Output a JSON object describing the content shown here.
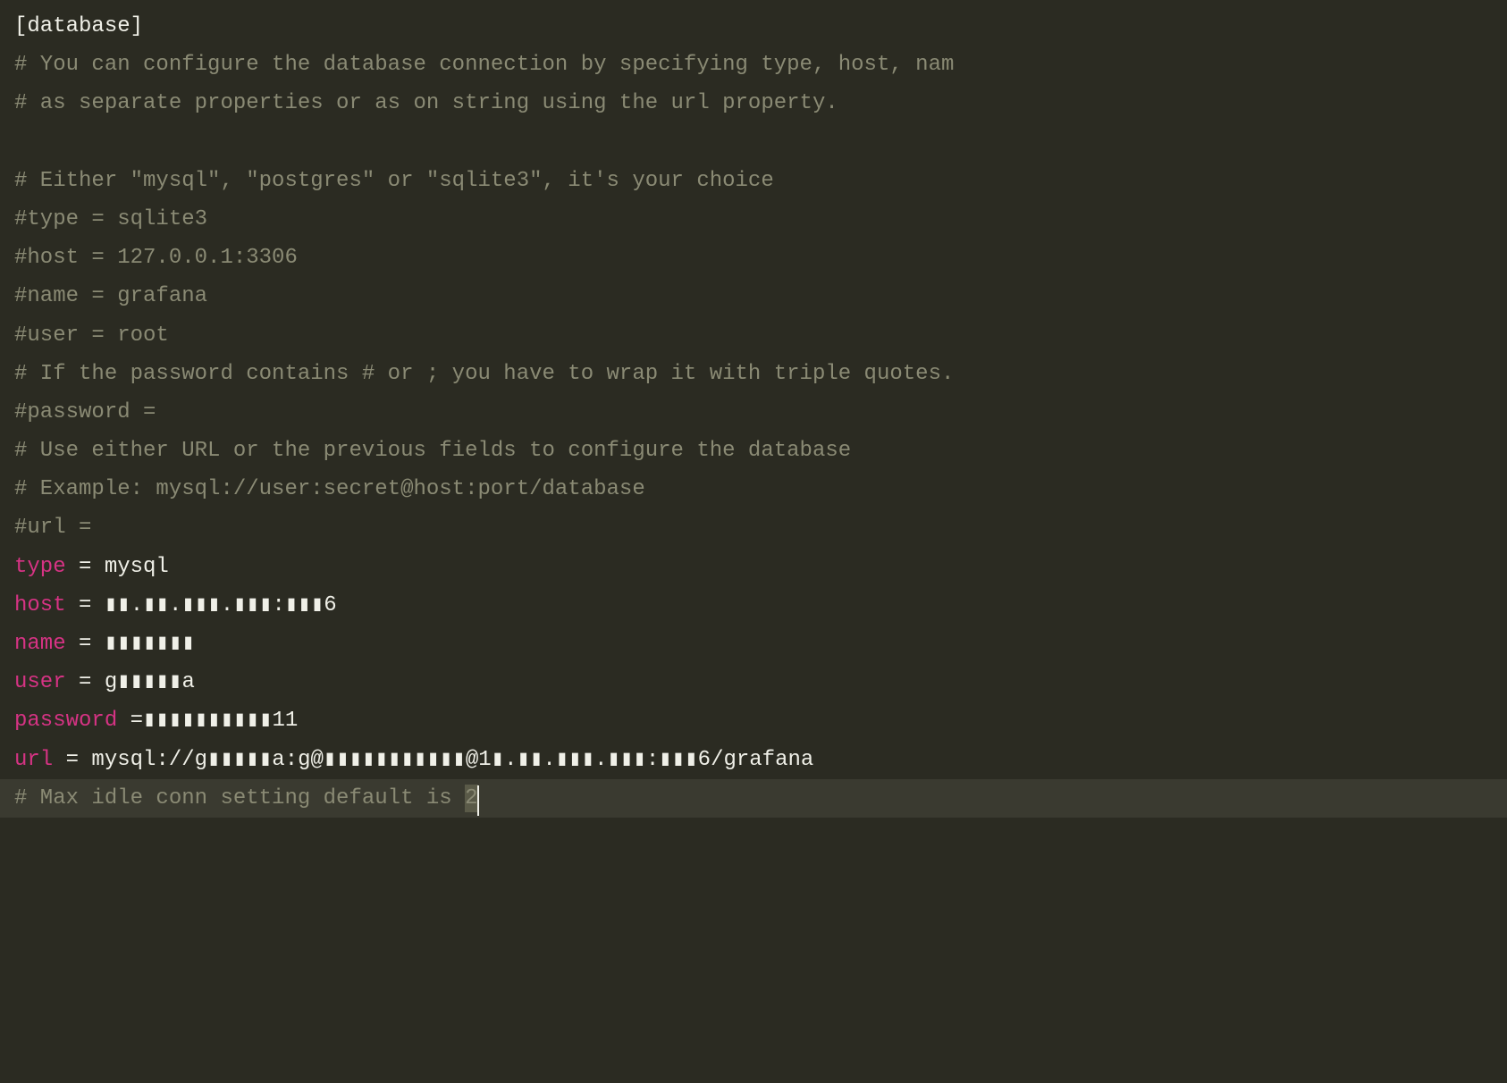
{
  "lines": {
    "l1": "[database]",
    "l2": "# You can configure the database connection by specifying type, host, nam",
    "l3": "# as separate properties or as on string using the url property.",
    "l4": "",
    "l5": "# Either \"mysql\", \"postgres\" or \"sqlite3\", it's your choice",
    "l6": "#type = sqlite3",
    "l7": "#host = 127.0.0.1:3306",
    "l8": "#name = grafana",
    "l9": "#user = root",
    "l10": "# If the password contains # or ; you have to wrap it with triple quotes.",
    "l11": "#password =",
    "l12": "# Use either URL or the previous fields to configure the database",
    "l13": "# Example: mysql://user:secret@host:port/database",
    "l14": "#url =",
    "type_key": "type",
    "type_val": " = mysql",
    "host_key": "host",
    "host_eq": " = ",
    "host_val": "▮▮.▮▮.▮▮▮.▮▮▮:▮▮▮6",
    "name_key": "name",
    "name_eq": " = ",
    "name_val": "▮▮▮▮▮▮▮",
    "user_key": "user",
    "user_eq": " = ",
    "user_val": "g▮▮▮▮▮a",
    "password_key": "password",
    "password_eq": " =",
    "password_val": "▮▮▮▮▮▮▮▮▮▮11",
    "url_key": "url",
    "url_eq": " = mysql://g",
    "url_val1": "▮▮▮▮▮a:g@▮▮▮▮▮▮▮▮▮▮▮@1▮.▮▮.▮▮▮.▮▮▮:▮▮▮6",
    "url_val2": "/grafana",
    "l21_pre": "# Max idle conn setting default is ",
    "l21_hl": "2"
  }
}
